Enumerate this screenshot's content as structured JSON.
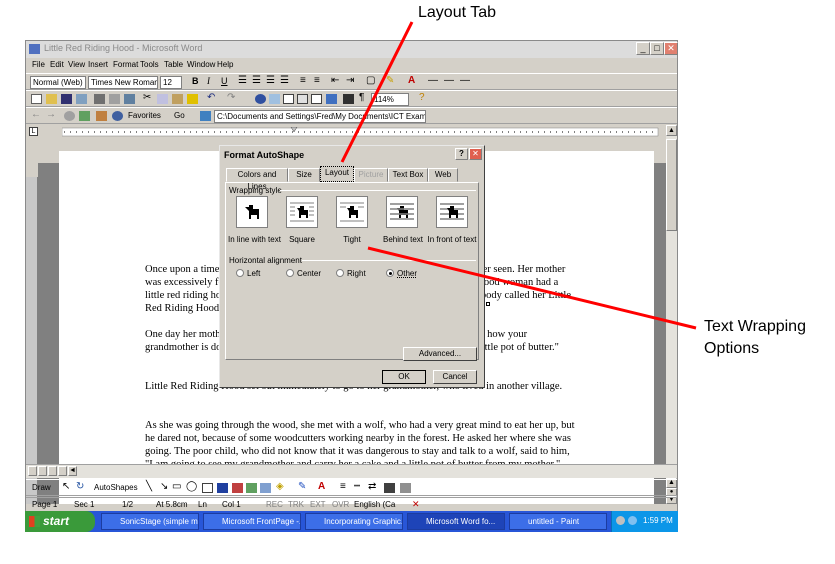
{
  "annotations": {
    "layout_tab": "Layout Tab",
    "wrapping_line1": "Text Wrapping",
    "wrapping_line2": "Options"
  },
  "window": {
    "title": "Little Red Riding Hood - Microsoft Word",
    "menu": [
      "File",
      "Edit",
      "View",
      "Insert",
      "Format",
      "Tools",
      "Table",
      "Window",
      "Help"
    ],
    "style_combo": "Normal (Web)",
    "font_combo": "Times New Roman",
    "size_combo": "12",
    "zoom_combo": "114%",
    "web": {
      "favorites": "Favorites",
      "go": "Go",
      "address": "C:\\Documents and Settings\\Fred\\My Documents\\ICT Examples\\Lit"
    }
  },
  "document": {
    "paragraphs": [
      "Once upon a time there was a little village girl, the prettiest creature who was ever seen. Her mother was excessively fond of her; and her grandmother doted on her still more. This good woman had a little red riding hood made for her. It suited the girl so extremely well that everybody called her Little Red Riding Hood.",
      "One day her mother, having made some cakes, said to her, \"Go, my dear, and see how your grandmother is doing, for I hear she has been very ill. Take her a cake, and this little pot of butter.\"",
      "Little Red Riding Hood set out immediately to go to her grandmother, who lived in another village.",
      "As she was going through the wood, she met with a wolf, who had a very great mind to eat her up, but he dared not, because of some woodcutters working nearby in the forest. He asked her where she was going. The poor child, who did not know that it was dangerous to stay and talk to a wolf, said to him, \"I am going to see my grandmother and carry her a cake and a little pot of butter from my mother.\""
    ]
  },
  "dialog": {
    "title": "Format AutoShape",
    "help": "?",
    "close": "✕",
    "tabs": [
      "Colors and Lines",
      "Size",
      "Layout",
      "Picture",
      "Text Box",
      "Web"
    ],
    "wrapping_label": "Wrapping style",
    "wrap_options": [
      "In line with text",
      "Square",
      "Tight",
      "Behind text",
      "In front of text"
    ],
    "align_label": "Horizontal alignment",
    "align_options": [
      "Left",
      "Center",
      "Right",
      "Other"
    ],
    "selected_align": "Other",
    "advanced": "Advanced...",
    "ok": "OK",
    "cancel": "Cancel"
  },
  "drawbar": {
    "draw": "Draw",
    "autoshapes": "AutoShapes"
  },
  "status": {
    "page": "Page 1",
    "sec": "Sec 1",
    "pages": "1/2",
    "at": "At 5.8cm",
    "ln": "Ln",
    "col": "Col 1",
    "rec": "REC",
    "trk": "TRK",
    "ext": "EXT",
    "ovr": "OVR",
    "lang": "English (Ca"
  },
  "taskbar": {
    "start": "start",
    "tasks": [
      "SonicStage (simple m...",
      "Microsoft FrontPage -...",
      "Incorporating Graphic...",
      "Microsoft Word fo...",
      "untitled - Paint"
    ],
    "time": "1:59 PM"
  },
  "colors": {
    "accent": "#ff0000",
    "titlebar_active": "#0a246a"
  }
}
